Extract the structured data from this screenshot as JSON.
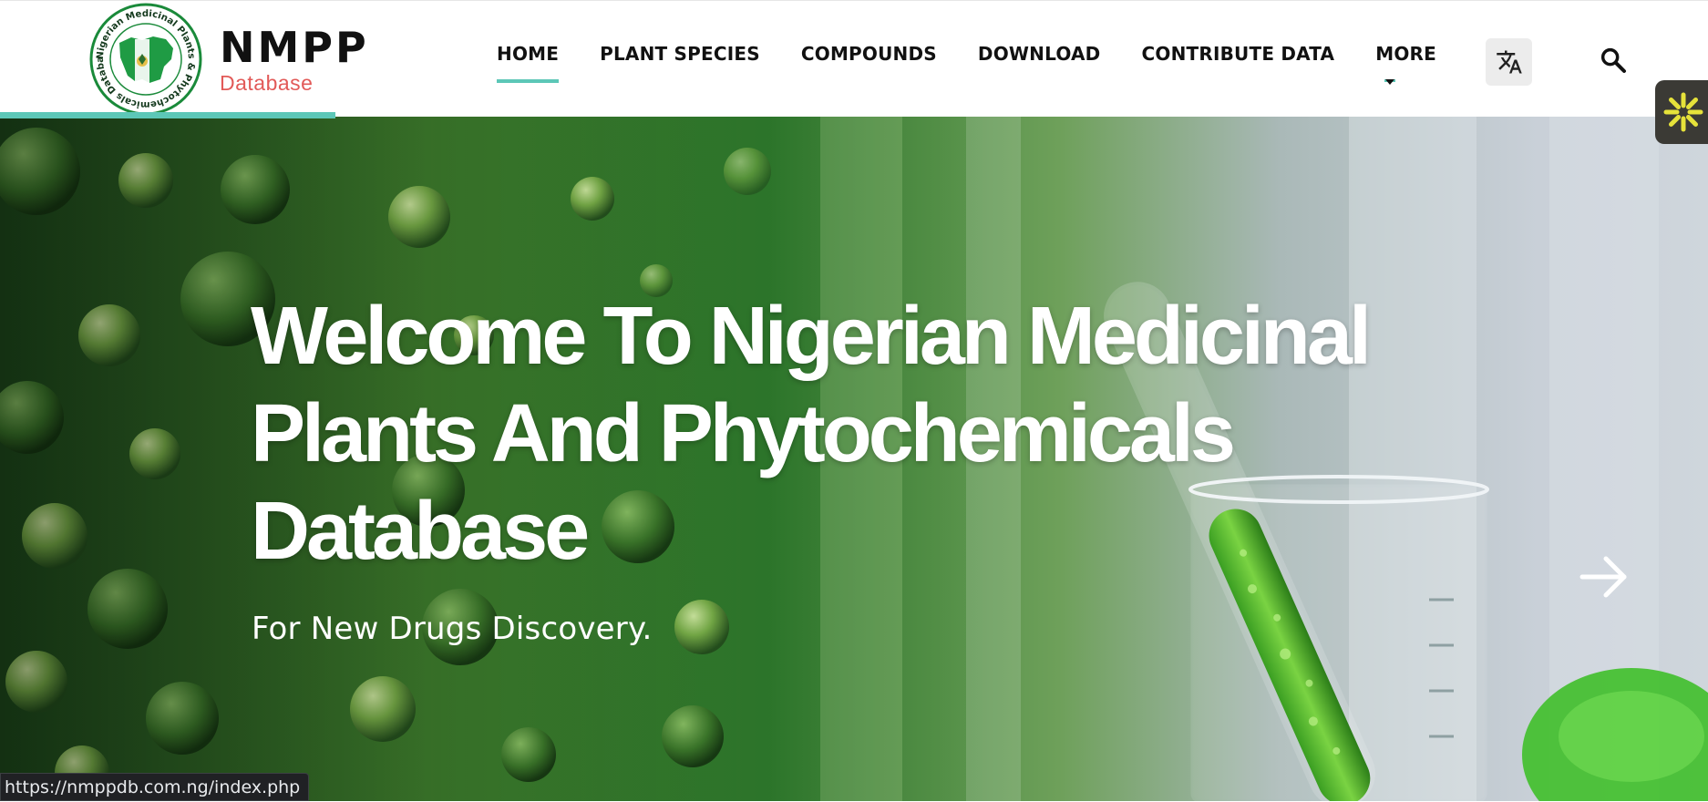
{
  "brand": {
    "name": "NMPP",
    "subtitle": "Database",
    "seal_text": "Nigerian Medicinal Plants & Phytochemicals Database"
  },
  "nav": {
    "items": [
      {
        "label": "HOME",
        "active": true
      },
      {
        "label": "PLANT SPECIES",
        "active": false
      },
      {
        "label": "COMPOUNDS",
        "active": false
      },
      {
        "label": "DOWNLOAD",
        "active": false
      },
      {
        "label": "CONTRIBUTE DATA",
        "active": false
      },
      {
        "label": "MORE",
        "active": false
      }
    ],
    "translate_icon": "translate-icon",
    "search_icon": "search-icon"
  },
  "hero": {
    "title": "Welcome To Nigerian Medicinal Plants And Phytochemicals Database",
    "subtitle": "For New Drugs Discovery.",
    "next_icon": "arrow-right-icon"
  },
  "status_bar": {
    "url": "https://nmppdb.com.ng/index.php"
  },
  "colors": {
    "accent": "#5cc7b7",
    "brand_sub": "#e25a58",
    "nav_text": "#111111",
    "seal_green": "#1a8a3a"
  }
}
